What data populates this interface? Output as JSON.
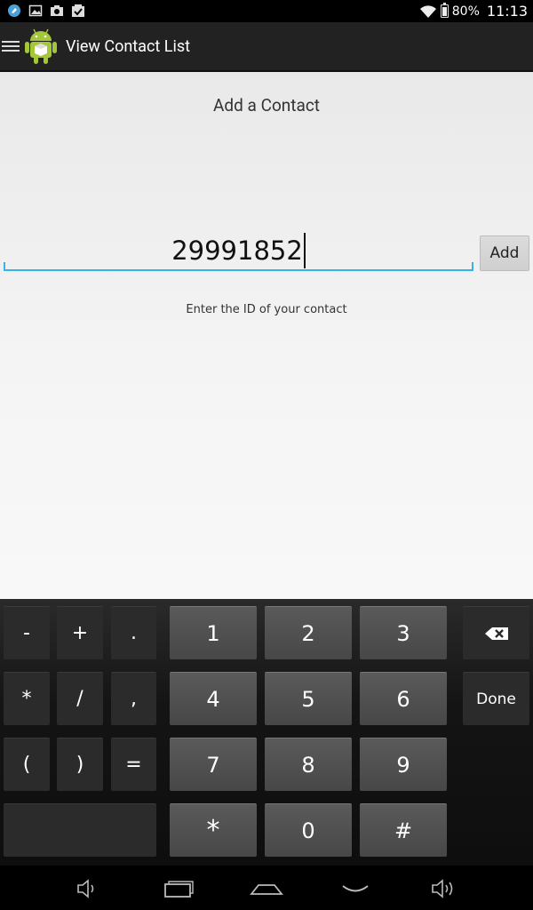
{
  "status_bar": {
    "battery_percent": "80%",
    "time": "11:13",
    "notification_icons": [
      "app-notification-icon",
      "image-icon",
      "camera-upload-icon",
      "task-check-icon"
    ]
  },
  "action_bar": {
    "title": "View Contact List"
  },
  "content": {
    "page_title": "Add a Contact",
    "id_field_value": "29991852",
    "add_button_label": "Add",
    "hint_text": "Enter the ID of your contact"
  },
  "keyboard": {
    "left_keys": [
      "-",
      "+",
      ".",
      "*",
      "/",
      ",",
      "(",
      ")",
      "="
    ],
    "digit_keys": [
      "1",
      "2",
      "3",
      "4",
      "5",
      "6",
      "7",
      "8",
      "9",
      "*",
      "0",
      "#"
    ],
    "done_label": "Done",
    "backspace_icon": "backspace-icon"
  },
  "nav_bar": {
    "icons": [
      "volume-down-icon",
      "recent-apps-icon",
      "home-icon",
      "hide-keyboard-icon",
      "volume-up-icon"
    ]
  }
}
